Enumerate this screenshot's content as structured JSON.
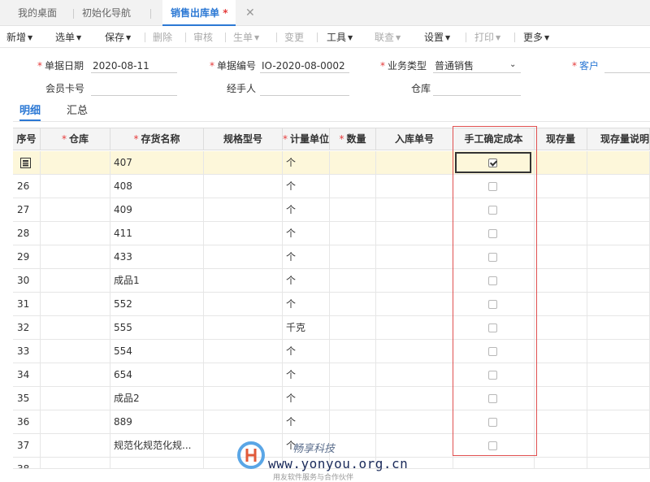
{
  "tabs": [
    {
      "label": "我的桌面",
      "active": false
    },
    {
      "label": "初始化导航",
      "active": false
    },
    {
      "label": "销售出库单",
      "active": true,
      "modified_mark": "*"
    }
  ],
  "toolbar": [
    {
      "label": "新增",
      "dropdown": true,
      "enabled": true
    },
    {
      "label": "选单",
      "dropdown": true,
      "enabled": true
    },
    {
      "label": "保存",
      "dropdown": true,
      "enabled": true
    },
    {
      "label": "删除",
      "dropdown": false,
      "enabled": false
    },
    {
      "label": "审核",
      "dropdown": false,
      "enabled": false
    },
    {
      "label": "生单",
      "dropdown": true,
      "enabled": false
    },
    {
      "label": "变更",
      "dropdown": false,
      "enabled": false
    },
    {
      "label": "工具",
      "dropdown": true,
      "enabled": true
    },
    {
      "label": "联查",
      "dropdown": true,
      "enabled": false
    },
    {
      "label": "设置",
      "dropdown": true,
      "enabled": true
    },
    {
      "label": "打印",
      "dropdown": true,
      "enabled": false
    },
    {
      "label": "更多",
      "dropdown": true,
      "enabled": true
    }
  ],
  "form": {
    "date_label": "单据日期",
    "date_value": "2020-08-11",
    "number_label": "单据编号",
    "number_value": "IO-2020-08-0002",
    "biz_type_label": "业务类型",
    "biz_type_value": "普通销售",
    "customer_label": "客户",
    "customer_value": "",
    "member_card_label": "会员卡号",
    "member_card_value": "",
    "handler_label": "经手人",
    "handler_value": "",
    "warehouse_label": "仓库",
    "warehouse_value": ""
  },
  "subtabs": [
    {
      "label": "明细",
      "active": true
    },
    {
      "label": "汇总",
      "active": false
    }
  ],
  "grid": {
    "columns": [
      {
        "label": "序号",
        "required": false
      },
      {
        "label": "仓库",
        "required": true
      },
      {
        "label": "存货名称",
        "required": true
      },
      {
        "label": "规格型号",
        "required": false
      },
      {
        "label": "计量单位",
        "required": true
      },
      {
        "label": "数量",
        "required": true
      },
      {
        "label": "入库单号",
        "required": false
      },
      {
        "label": "手工确定成本",
        "required": false
      },
      {
        "label": "现存量",
        "required": false
      },
      {
        "label": "现存量说明",
        "required": false
      }
    ],
    "rows": [
      {
        "no": "",
        "name": "407",
        "unit": "个",
        "manual_cost": true,
        "selected": true
      },
      {
        "no": "26",
        "name": "408",
        "unit": "个",
        "manual_cost": false
      },
      {
        "no": "27",
        "name": "409",
        "unit": "个",
        "manual_cost": false
      },
      {
        "no": "28",
        "name": "411",
        "unit": "个",
        "manual_cost": false
      },
      {
        "no": "29",
        "name": "433",
        "unit": "个",
        "manual_cost": false
      },
      {
        "no": "30",
        "name": "成品1",
        "unit": "个",
        "manual_cost": false
      },
      {
        "no": "31",
        "name": "552",
        "unit": "个",
        "manual_cost": false
      },
      {
        "no": "32",
        "name": "555",
        "unit": "千克",
        "manual_cost": false
      },
      {
        "no": "33",
        "name": "554",
        "unit": "个",
        "manual_cost": false
      },
      {
        "no": "34",
        "name": "654",
        "unit": "个",
        "manual_cost": false
      },
      {
        "no": "35",
        "name": "成品2",
        "unit": "个",
        "manual_cost": false
      },
      {
        "no": "36",
        "name": "889",
        "unit": "个",
        "manual_cost": false
      },
      {
        "no": "37",
        "name": "规范化规范化规...",
        "unit": "个",
        "manual_cost": false
      },
      {
        "no": "38",
        "name": "",
        "unit": "",
        "manual_cost": false
      }
    ]
  },
  "watermark": {
    "cn": "畅享科技",
    "url": "www.yonyou.org.cn",
    "sub": "用友软件服务与合作伙伴"
  },
  "colors": {
    "accent": "#2b78d4",
    "required": "#e53b3b",
    "highlight_frame": "#e05050",
    "selected_row": "#fdf7da"
  }
}
